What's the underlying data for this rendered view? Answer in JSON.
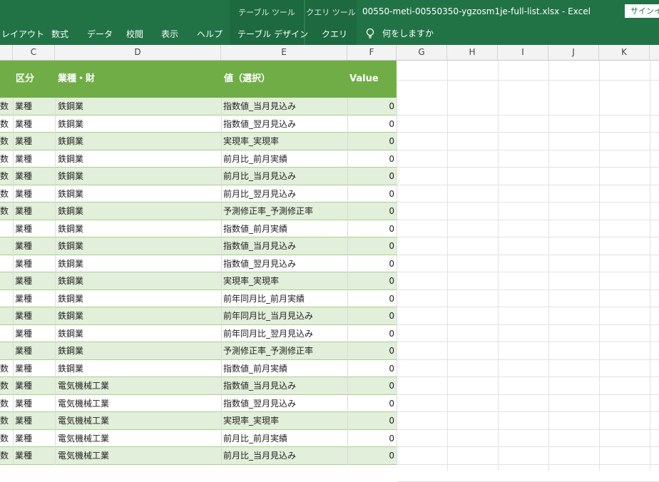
{
  "titlebar": {
    "table_tools": "テーブル ツール",
    "query_tools": "クエリ ツール",
    "file_title": "00550-meti-00550350-ygzosm1je-full-list.xlsx  -  Excel",
    "signin": "サインイン"
  },
  "ribbon": {
    "tabs": [
      "レイアウト",
      "数式",
      "データ",
      "校閲",
      "表示",
      "ヘルプ",
      "テーブル デザイン",
      "クエリ"
    ],
    "tell_me": "何をしますか"
  },
  "columns": [
    "C",
    "D",
    "E",
    "F",
    "G",
    "H",
    "I",
    "J",
    "K"
  ],
  "table": {
    "headers": {
      "c": "区分",
      "d": "業種・財",
      "e": "値（選択）",
      "f": "Value"
    },
    "rows": [
      {
        "b": "数",
        "c": "業種",
        "d": "鉄鋼業",
        "e": "指数値_当月見込み",
        "f": "0"
      },
      {
        "b": "数",
        "c": "業種",
        "d": "鉄鋼業",
        "e": "指数値_翌月見込み",
        "f": "0"
      },
      {
        "b": "数",
        "c": "業種",
        "d": "鉄鋼業",
        "e": "実現率_実現率",
        "f": "0"
      },
      {
        "b": "数",
        "c": "業種",
        "d": "鉄鋼業",
        "e": "前月比_前月実績",
        "f": "0"
      },
      {
        "b": "数",
        "c": "業種",
        "d": "鉄鋼業",
        "e": "前月比_当月見込み",
        "f": "0"
      },
      {
        "b": "数",
        "c": "業種",
        "d": "鉄鋼業",
        "e": "前月比_翌月見込み",
        "f": "0"
      },
      {
        "b": "数",
        "c": "業種",
        "d": "鉄鋼業",
        "e": "予測修正率_予測修正率",
        "f": "0"
      },
      {
        "b": "",
        "c": "業種",
        "d": "鉄鋼業",
        "e": "指数値_前月実績",
        "f": "0"
      },
      {
        "b": "",
        "c": "業種",
        "d": "鉄鋼業",
        "e": "指数値_当月見込み",
        "f": "0"
      },
      {
        "b": "",
        "c": "業種",
        "d": "鉄鋼業",
        "e": "指数値_翌月見込み",
        "f": "0"
      },
      {
        "b": "",
        "c": "業種",
        "d": "鉄鋼業",
        "e": "実現率_実現率",
        "f": "0"
      },
      {
        "b": "",
        "c": "業種",
        "d": "鉄鋼業",
        "e": "前年同月比_前月実績",
        "f": "0"
      },
      {
        "b": "",
        "c": "業種",
        "d": "鉄鋼業",
        "e": "前年同月比_当月見込み",
        "f": "0"
      },
      {
        "b": "",
        "c": "業種",
        "d": "鉄鋼業",
        "e": "前年同月比_翌月見込み",
        "f": "0"
      },
      {
        "b": "",
        "c": "業種",
        "d": "鉄鋼業",
        "e": "予測修正率_予測修正率",
        "f": "0"
      },
      {
        "b": "数",
        "c": "業種",
        "d": "鉄鋼業",
        "e": "指数値_前月実績",
        "f": "0"
      },
      {
        "b": "数",
        "c": "業種",
        "d": "電気機械工業",
        "e": "指数値_当月見込み",
        "f": "0"
      },
      {
        "b": "数",
        "c": "業種",
        "d": "電気機械工業",
        "e": "指数値_翌月見込み",
        "f": "0"
      },
      {
        "b": "数",
        "c": "業種",
        "d": "電気機械工業",
        "e": "実現率_実現率",
        "f": "0"
      },
      {
        "b": "数",
        "c": "業種",
        "d": "電気機械工業",
        "e": "前月比_前月実績",
        "f": "0"
      },
      {
        "b": "数",
        "c": "業種",
        "d": "電気機械工業",
        "e": "前月比_当月見込み",
        "f": "0"
      }
    ]
  },
  "colors": {
    "ribbon": "#217346",
    "table_header": "#70ad47",
    "band": "#e2efda"
  }
}
